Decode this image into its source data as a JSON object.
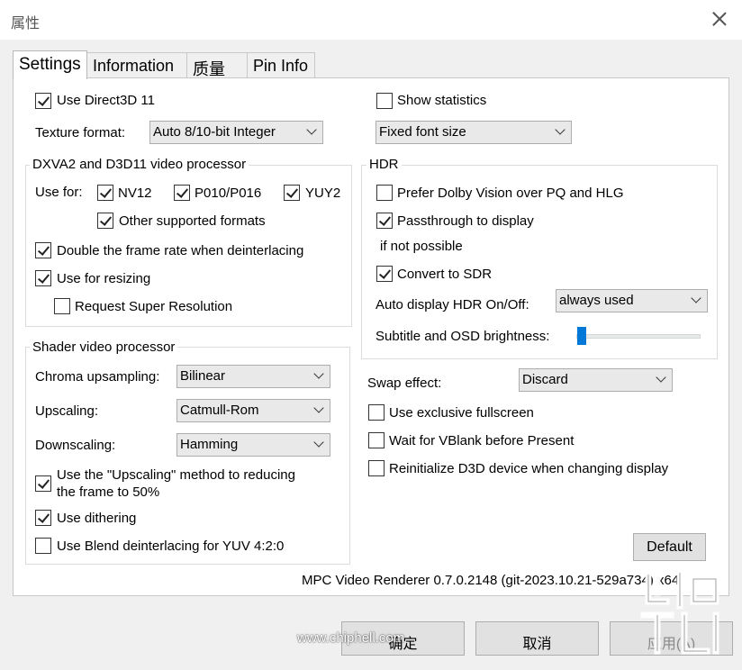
{
  "window": {
    "title": "属性"
  },
  "tabs": [
    "Settings",
    "Information",
    "质量",
    "Pin Info"
  ],
  "settings": {
    "use_d3d11": {
      "label": "Use Direct3D 11",
      "checked": true
    },
    "texture_format": {
      "label": "Texture format:",
      "value": "Auto 8/10-bit Integer"
    },
    "show_statistics": {
      "label": "Show statistics",
      "checked": false
    },
    "font_size": {
      "value": "Fixed font size"
    },
    "dxva": {
      "title": "DXVA2 and D3D11 video processor",
      "use_for": "Use for:",
      "nv12": {
        "label": "NV12",
        "checked": true
      },
      "p010": {
        "label": "P010/P016",
        "checked": true
      },
      "yuy2": {
        "label": "YUY2",
        "checked": true
      },
      "other": {
        "label": "Other supported formats",
        "checked": true
      },
      "double_rate": {
        "label": "Double the frame rate when deinterlacing",
        "checked": true
      },
      "resizing": {
        "label": "Use for resizing",
        "checked": true
      },
      "super_res": {
        "label": "Request Super Resolution",
        "checked": false
      }
    },
    "hdr": {
      "title": "HDR",
      "dolby": {
        "label": "Prefer Dolby Vision over PQ and HLG",
        "checked": false
      },
      "passthrough": {
        "label": "Passthrough to display",
        "checked": true
      },
      "if_not": "if not possible",
      "convert_sdr": {
        "label": "Convert to SDR",
        "checked": true
      },
      "auto_display": {
        "label": "Auto display HDR On/Off:",
        "value": "always used"
      },
      "brightness": {
        "label": "Subtitle and OSD brightness:",
        "level": 0
      }
    },
    "shader": {
      "title": "Shader video processor",
      "chroma": {
        "label": "Chroma upsampling:",
        "value": "Bilinear"
      },
      "upscaling": {
        "label": "Upscaling:",
        "value": "Catmull-Rom"
      },
      "downscaling": {
        "label": "Downscaling:",
        "value": "Hamming"
      },
      "upscale_method": {
        "line1": "Use the \"Upscaling\" method to reducing",
        "line2": "the frame to 50%",
        "checked": true
      },
      "dithering": {
        "label": "Use dithering",
        "checked": true
      },
      "blend": {
        "label": "Use Blend deinterlacing for YUV 4:2:0",
        "checked": false
      }
    },
    "swap_effect": {
      "label": "Swap effect:",
      "value": "Discard"
    },
    "exclusive_fullscreen": {
      "label": "Use exclusive fullscreen",
      "checked": false
    },
    "vblank": {
      "label": "Wait for VBlank before Present",
      "checked": false
    },
    "reinit": {
      "label": "Reinitialize D3D device when changing display",
      "checked": false
    },
    "default_button": "Default",
    "version": "MPC Video Renderer 0.7.0.2148 (git-2023.10.21-529a734) x64"
  },
  "footer": {
    "ok": "确定",
    "cancel": "取消",
    "apply": "应用(A)"
  },
  "watermark": "www.chiphell.com"
}
